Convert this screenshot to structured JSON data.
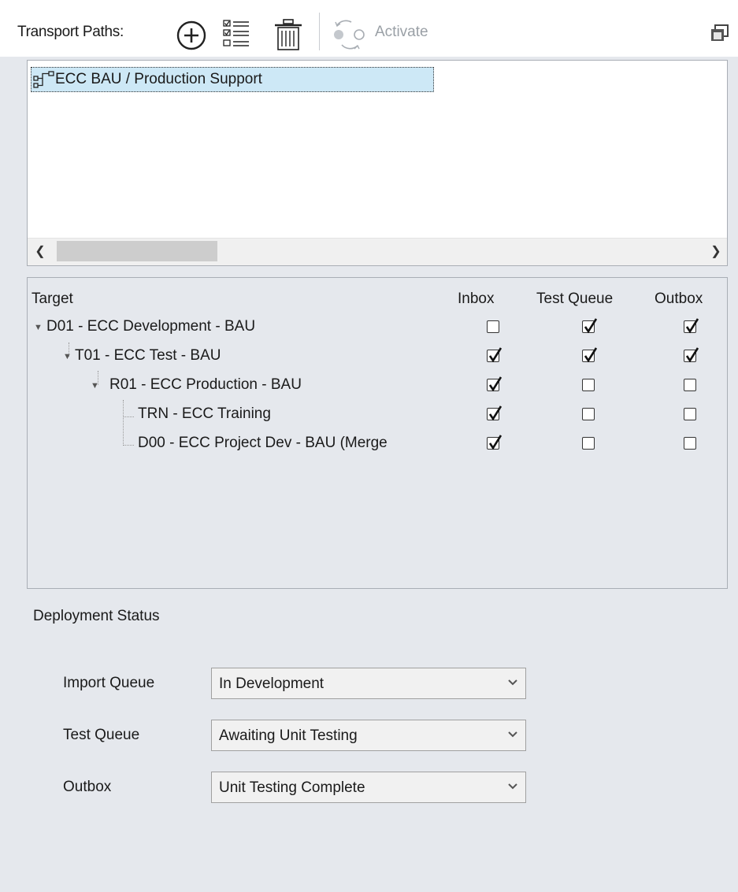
{
  "toolbar": {
    "title": "Transport Paths:",
    "activate_label": "Activate",
    "icons": [
      "plus-circle-icon",
      "checklist-icon",
      "trash-icon",
      "activate-icon",
      "window-icon"
    ]
  },
  "paths": {
    "items": [
      {
        "label": "ECC BAU / Production Support",
        "selected": true
      }
    ]
  },
  "targets": {
    "headers": {
      "target": "Target",
      "inbox": "Inbox",
      "test_queue": "Test Queue",
      "outbox": "Outbox"
    },
    "rows": [
      {
        "label": "D01 - ECC Development - BAU",
        "level": 0,
        "expanded": true,
        "inbox": false,
        "test_queue": true,
        "outbox": true
      },
      {
        "label": "T01 - ECC Test - BAU",
        "level": 1,
        "expanded": true,
        "inbox": true,
        "test_queue": true,
        "outbox": true
      },
      {
        "label": "R01 - ECC Production - BAU",
        "level": 2,
        "expanded": true,
        "inbox": true,
        "test_queue": false,
        "outbox": false
      },
      {
        "label": "TRN - ECC Training",
        "level": 3,
        "expanded": null,
        "inbox": true,
        "test_queue": false,
        "outbox": false
      },
      {
        "label": "D00 - ECC Project Dev - BAU (Merge",
        "level": 3,
        "expanded": null,
        "inbox": true,
        "test_queue": false,
        "outbox": false
      }
    ]
  },
  "deployment": {
    "title": "Deployment Status",
    "fields": [
      {
        "label": "Import Queue",
        "value": "In Development"
      },
      {
        "label": "Test Queue",
        "value": "Awaiting Unit Testing"
      },
      {
        "label": "Outbox",
        "value": "Unit Testing Complete"
      }
    ]
  },
  "colors": {
    "background": "#e5e8ed",
    "selection": "#cde8f6",
    "disabled_text": "#9aa0a6"
  }
}
